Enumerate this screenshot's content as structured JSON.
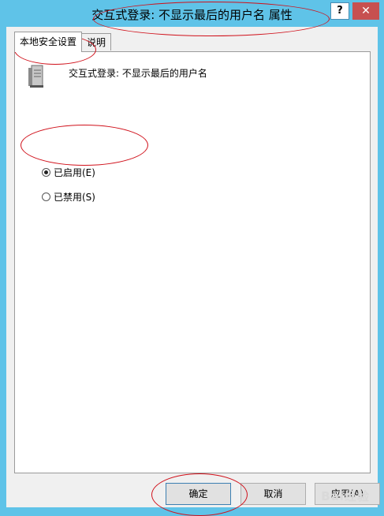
{
  "window": {
    "title": "交互式登录: 不显示最后的用户名 属性",
    "help_label": "?",
    "close_icon": "close-icon"
  },
  "tabs": [
    {
      "label": "本地安全设置",
      "selected": true
    },
    {
      "label": "说明",
      "selected": false
    }
  ],
  "policy": {
    "icon": "server-icon",
    "name": "交互式登录: 不显示最后的用户名"
  },
  "options": [
    {
      "label": "已启用(E)",
      "checked": true
    },
    {
      "label": "已禁用(S)",
      "checked": false
    }
  ],
  "buttons": {
    "ok": "确定",
    "cancel": "取消",
    "apply": "应用(A)"
  },
  "watermark": "Bai经验",
  "colors": {
    "frame": "#5fc3e8",
    "close": "#c75050",
    "annotation": "#d0101a"
  }
}
